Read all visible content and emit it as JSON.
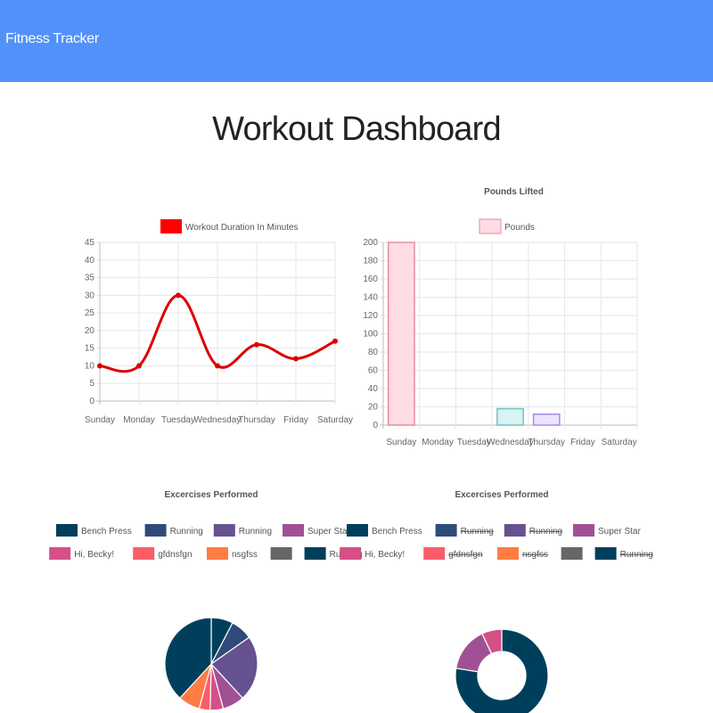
{
  "navbar": {
    "brand": "Fitness Tracker"
  },
  "page": {
    "title": "Workout Dashboard"
  },
  "colors": {
    "navbar": "#5291f9",
    "line": "#dd0000",
    "legend_line": "#ff0000"
  },
  "chart_data": [
    {
      "type": "line",
      "title": "",
      "categories": [
        "Sunday",
        "Monday",
        "Tuesday",
        "Wednesday",
        "Thursday",
        "Friday",
        "Saturday"
      ],
      "series": [
        {
          "name": "Workout Duration In Minutes",
          "values": [
            10,
            10,
            30,
            10,
            16,
            12,
            17
          ],
          "color": "#dd0000"
        }
      ],
      "yticks": [
        0,
        5,
        10,
        15,
        20,
        25,
        30,
        35,
        40,
        45
      ],
      "ylim": [
        0,
        45
      ],
      "grid": true,
      "legend": "top"
    },
    {
      "type": "bar",
      "title": "Pounds Lifted",
      "categories": [
        "Sunday",
        "Monday",
        "Tuesday",
        "Wednesday",
        "Thursday",
        "Friday",
        "Saturday"
      ],
      "series": [
        {
          "name": "Pounds",
          "values": [
            200,
            0,
            0,
            18,
            12,
            0,
            0
          ]
        }
      ],
      "bar_colors": [
        "#ffdce4",
        "#e8e8e8",
        "#fff2cc",
        "#d9f2f2",
        "#ece3ff",
        "#ffe8cc",
        "#e8e8e8"
      ],
      "bar_borders": [
        "#e88aa0",
        "#bbbbbb",
        "#e8c060",
        "#6cc4c4",
        "#a98aea",
        "#f0a050",
        "#bbbbbb"
      ],
      "yticks": [
        0,
        20,
        40,
        60,
        80,
        100,
        120,
        140,
        160,
        180,
        200
      ],
      "ylim": [
        0,
        200
      ],
      "grid": true,
      "legend": "top"
    },
    {
      "type": "pie",
      "title": "Excercises Performed",
      "labels": [
        "Bench Press",
        "Running",
        "Running",
        "Super Star",
        "Hi, Becky!",
        "gfdnsfgn",
        "nsgfss",
        "",
        "Running"
      ],
      "values": [
        10,
        10,
        30,
        10,
        6,
        5,
        10,
        0,
        50
      ],
      "colors": [
        "#003f5c",
        "#2f4b7c",
        "#665191",
        "#a05195",
        "#d45087",
        "#f95d6a",
        "#ff7c43",
        "#666666",
        "#003f5c"
      ],
      "legend": "top"
    },
    {
      "type": "pie",
      "title": "Excercises Performed",
      "labels": [
        "Bench Press",
        "Running",
        "Running",
        "Super Star",
        "Hi, Becky!",
        "gfdnsfgn",
        "nsgfss",
        "",
        "Running"
      ],
      "values": [
        200,
        30,
        30,
        40,
        18,
        12,
        10,
        0,
        30
      ],
      "hidden": [
        false,
        true,
        true,
        false,
        false,
        true,
        true,
        false,
        true
      ],
      "colors": [
        "#003f5c",
        "#2f4b7c",
        "#665191",
        "#a05195",
        "#d45087",
        "#f95d6a",
        "#ff7c43",
        "#666666",
        "#003f5c"
      ],
      "legend": "top",
      "doughnut": true
    }
  ]
}
